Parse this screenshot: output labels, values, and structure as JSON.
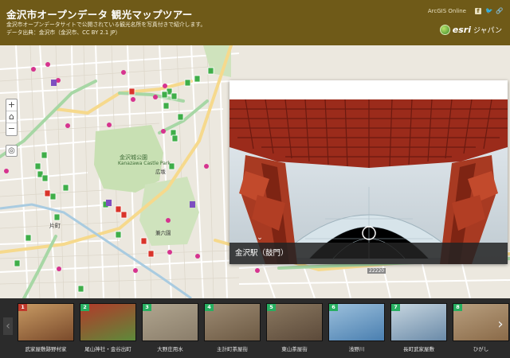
{
  "header": {
    "title": "金沢市オープンデータ 観光マップツアー",
    "subtitle_line1": "金沢市オープンデータサイトで公開されている観光名所を写真付きで紹介します。",
    "subtitle_line2": "データ出典：金沢市（金沢市、CC BY 2.1 JP）",
    "arcgis_link": "ArcGIS Online",
    "esri_text": "esri",
    "esri_jp": "ジャパン"
  },
  "map": {
    "zoom_in": "+",
    "home": "⌂",
    "zoom_out": "−",
    "locate": "◎",
    "labels": {
      "park": "金沢城公園",
      "park_en": "Kanazawa Castle Park",
      "hirosaka": "広坂",
      "katamachi": "片町",
      "kenrokuen": "兼六園",
      "route_top": "22220",
      "route_bottom": "22220"
    }
  },
  "popup": {
    "caption": "金沢駅（鼓門）"
  },
  "carousel": {
    "items": [
      {
        "num": "1",
        "label": "武家屋敷跡野村家",
        "color": "#c0392b"
      },
      {
        "num": "2",
        "label": "尾山神社・金谷出町",
        "color": "#27ae60"
      },
      {
        "num": "3",
        "label": "大野庄用水",
        "color": "#27ae60"
      },
      {
        "num": "4",
        "label": "主計町茶屋街",
        "color": "#27ae60"
      },
      {
        "num": "5",
        "label": "東山茶屋街",
        "color": "#27ae60"
      },
      {
        "num": "6",
        "label": "浅野川",
        "color": "#27ae60"
      },
      {
        "num": "7",
        "label": "長町武家屋敷",
        "color": "#27ae60"
      },
      {
        "num": "8",
        "label": "ひがし",
        "color": "#27ae60"
      }
    ]
  },
  "colors": {
    "header_bg": "#6f5a18",
    "marker_red": "#d9342b",
    "marker_green": "#3fae49",
    "marker_pink": "#d6338f",
    "park_green": "#c8e0b3"
  }
}
